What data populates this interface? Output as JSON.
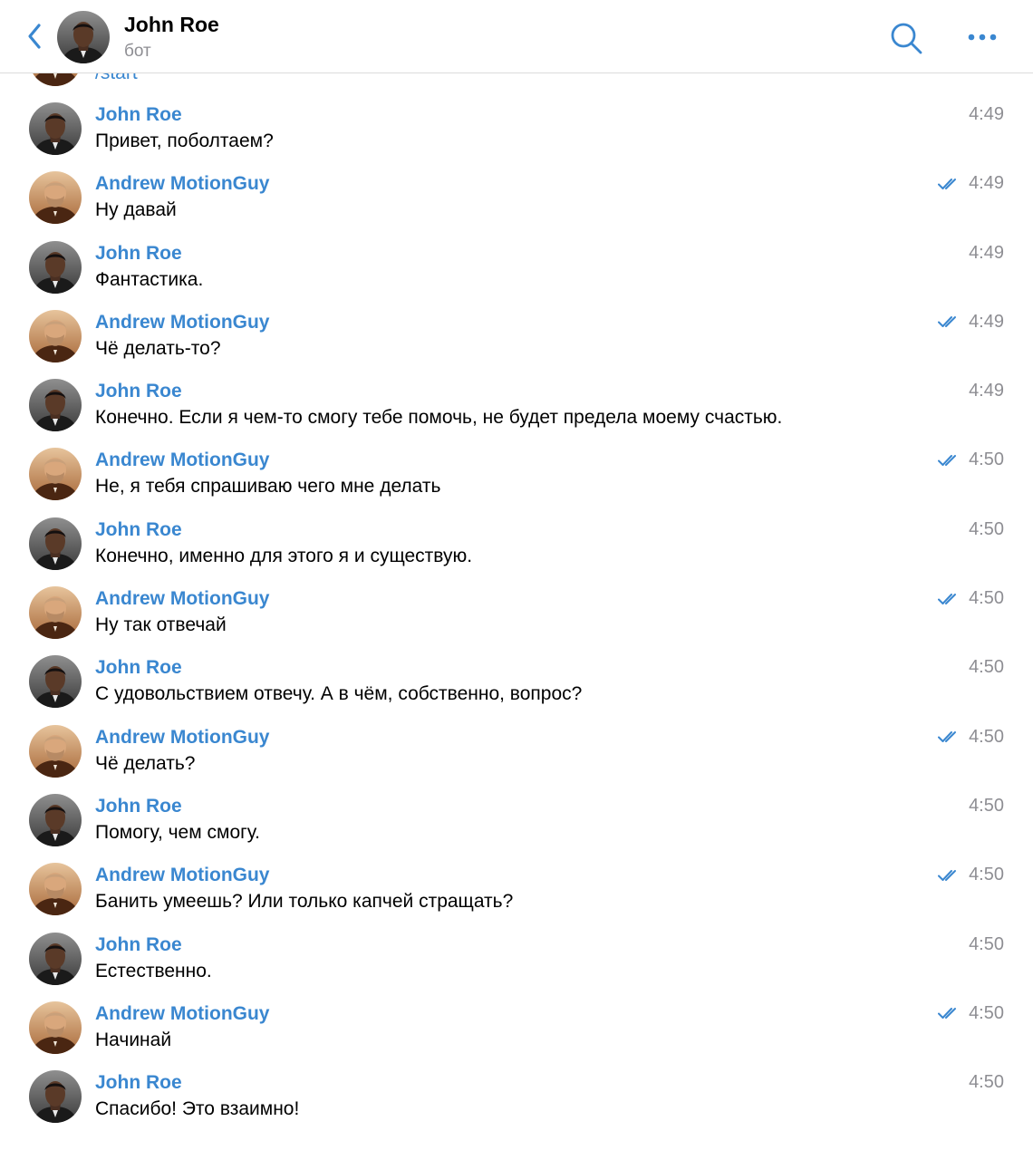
{
  "header": {
    "title": "John Roe",
    "subtitle": "бот",
    "back_icon": "chevron-left-icon",
    "search_icon": "search-icon",
    "more_icon": "more-dots-icon",
    "accent_color": "#3a87d0"
  },
  "partial_message": {
    "text": "/start"
  },
  "messages": [
    {
      "sender": "John Roe",
      "avatar": "john",
      "text": "Привет, поболтаем?",
      "time": "4:49",
      "read": false
    },
    {
      "sender": "Andrew MotionGuy",
      "avatar": "andrew",
      "text": "Ну давай",
      "time": "4:49",
      "read": true
    },
    {
      "sender": "John Roe",
      "avatar": "john",
      "text": "Фантастика.",
      "time": "4:49",
      "read": false
    },
    {
      "sender": "Andrew MotionGuy",
      "avatar": "andrew",
      "text": "Чё делать-то?",
      "time": "4:49",
      "read": true
    },
    {
      "sender": "John Roe",
      "avatar": "john",
      "text": "Конечно. Если я чем-то смогу тебе помочь, не будет предела моему счастью.",
      "time": "4:49",
      "read": false
    },
    {
      "sender": "Andrew MotionGuy",
      "avatar": "andrew",
      "text": "Не, я тебя спрашиваю чего мне делать",
      "time": "4:50",
      "read": true
    },
    {
      "sender": "John Roe",
      "avatar": "john",
      "text": "Конечно, именно для этого я и существую.",
      "time": "4:50",
      "read": false
    },
    {
      "sender": "Andrew MotionGuy",
      "avatar": "andrew",
      "text": "Ну так отвечай",
      "time": "4:50",
      "read": true
    },
    {
      "sender": "John Roe",
      "avatar": "john",
      "text": "С удовольствием отвечу. А в чём, собственно, вопрос?",
      "time": "4:50",
      "read": false
    },
    {
      "sender": "Andrew MotionGuy",
      "avatar": "andrew",
      "text": "Чё делать?",
      "time": "4:50",
      "read": true
    },
    {
      "sender": "John Roe",
      "avatar": "john",
      "text": "Помогу, чем смогу.",
      "time": "4:50",
      "read": false
    },
    {
      "sender": "Andrew MotionGuy",
      "avatar": "andrew",
      "text": "Банить умеешь? Или только капчей стращать?",
      "time": "4:50",
      "read": true
    },
    {
      "sender": "John Roe",
      "avatar": "john",
      "text": "Естественно.",
      "time": "4:50",
      "read": false
    },
    {
      "sender": "Andrew MotionGuy",
      "avatar": "andrew",
      "text": "Начинай",
      "time": "4:50",
      "read": true
    },
    {
      "sender": "John Roe",
      "avatar": "john",
      "text": "Спасибо! Это взаимно!",
      "time": "4:50",
      "read": false
    }
  ]
}
